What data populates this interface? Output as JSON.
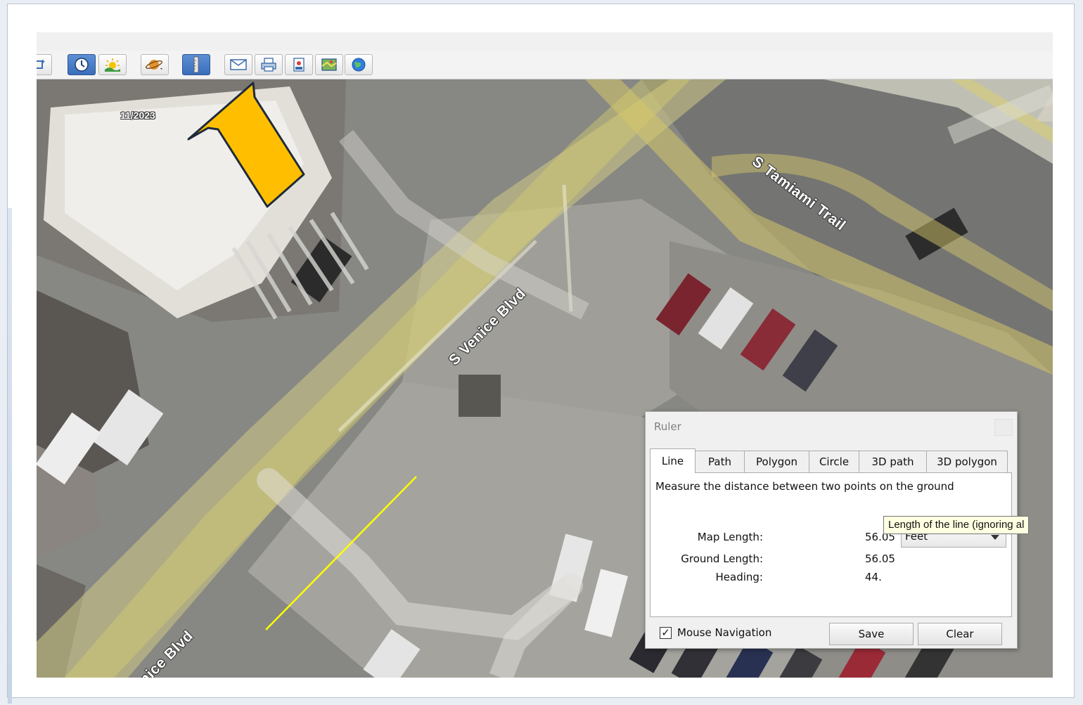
{
  "toolbar": {
    "buttons": [
      {
        "name": "add-placemark-icon"
      },
      {
        "name": "historical-imagery-icon",
        "active": true
      },
      {
        "name": "sunlight-icon"
      },
      {
        "name": "planets-icon"
      },
      {
        "name": "ruler-icon",
        "active": true
      },
      {
        "name": "email-icon"
      },
      {
        "name": "print-icon"
      },
      {
        "name": "save-image-icon"
      },
      {
        "name": "view-in-maps-icon"
      },
      {
        "name": "earth-icon"
      }
    ]
  },
  "map": {
    "imagery_date": "11/2023",
    "road_labels": {
      "tamiami": "S Tamiami Trail",
      "venice_upper": "S Venice Blvd",
      "venice_lower": "S Venice Blvd"
    },
    "measure_line_color": "#ffff00",
    "road_overlay_color": "#d8d27a"
  },
  "callout": {
    "color": "#ffbf00",
    "outline": "#1f2b3a"
  },
  "ruler": {
    "title": "Ruler",
    "tabs": [
      "Line",
      "Path",
      "Polygon",
      "Circle",
      "3D path",
      "3D polygon"
    ],
    "active_tab": "Line",
    "description": "Measure the distance between two points on the ground",
    "map_length_label": "Map Length:",
    "map_length_value": "56.05",
    "units": "Feet",
    "ground_length_label": "Ground Length:",
    "ground_length_value": "56.05",
    "heading_label": "Heading:",
    "heading_value": "44.",
    "tooltip": "Length of the line (ignoring al",
    "mouse_navigation_label": "Mouse Navigation",
    "mouse_navigation_checked": "✓",
    "save_label": "Save",
    "clear_label": "Clear"
  }
}
